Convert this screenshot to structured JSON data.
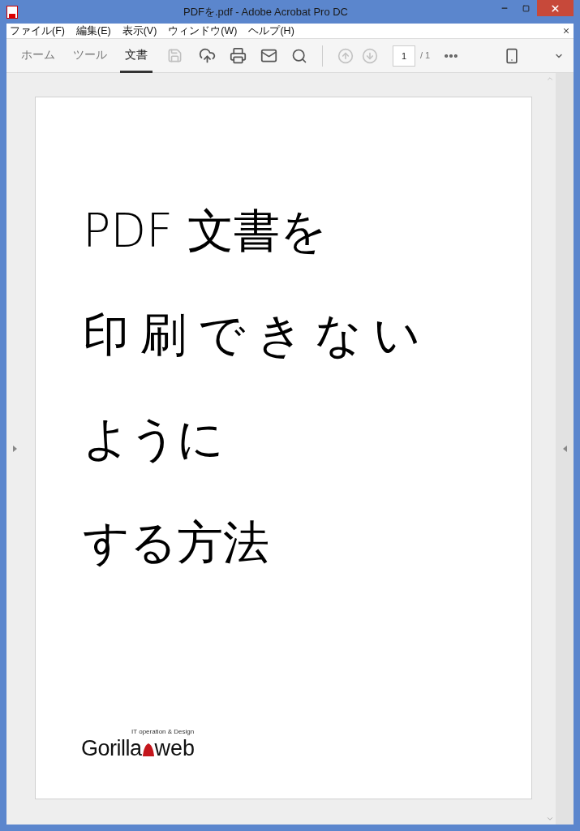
{
  "window": {
    "title": "PDFを.pdf - Adobe Acrobat Pro DC"
  },
  "menu": [
    "ファイル(F)",
    "編集(E)",
    "表示(V)",
    "ウィンドウ(W)",
    "ヘルプ(H)"
  ],
  "tabs": [
    {
      "label": "ホーム",
      "selected": false
    },
    {
      "label": "ツール",
      "selected": false
    },
    {
      "label": "文書",
      "selected": true
    }
  ],
  "toolbar": {
    "page": "1",
    "page_total": "/ 1"
  },
  "document": {
    "lines": [
      "PDF 文書を",
      "印刷できない",
      "ように",
      "する方法"
    ],
    "logo": {
      "tagline": "IT operation & Design",
      "left": "Gorilla",
      "right": "web"
    }
  }
}
